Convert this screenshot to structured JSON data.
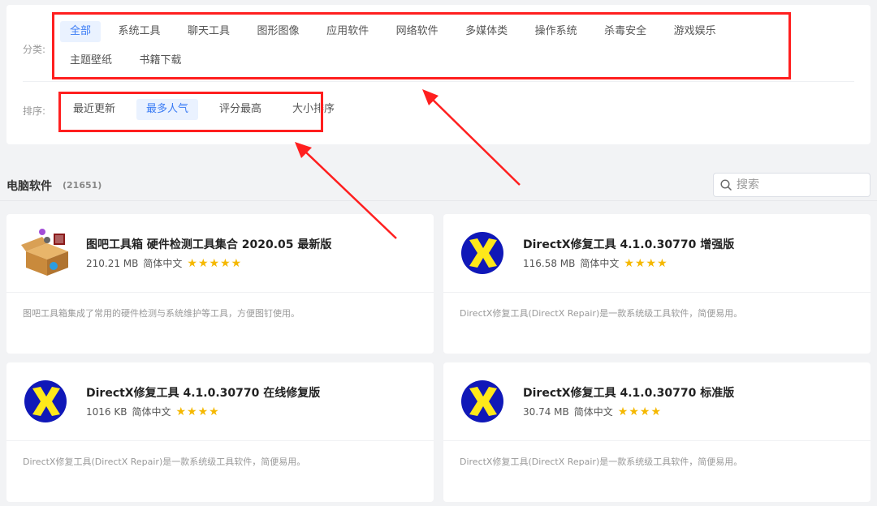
{
  "filters": {
    "category_label": "分类:",
    "categories": [
      "全部",
      "系统工具",
      "聊天工具",
      "图形图像",
      "应用软件",
      "网络软件",
      "多媒体类",
      "操作系统",
      "杀毒安全",
      "游戏娱乐",
      "主题壁纸",
      "书籍下载"
    ],
    "active_category": 0,
    "sort_label": "排序:",
    "sorts": [
      "最近更新",
      "最多人气",
      "评分最高",
      "大小排序"
    ],
    "active_sort": 1
  },
  "section": {
    "title": "电脑软件",
    "count": "(21651)"
  },
  "search": {
    "placeholder": "搜索"
  },
  "cards": [
    {
      "icon": "toolbox-icon",
      "title": "图吧工具箱 硬件检测工具集合 2020.05 最新版",
      "size": "210.21 MB",
      "lang": "简体中文",
      "stars": 5,
      "desc": "图吧工具箱集成了常用的硬件检测与系统维护等工具，方便图钉使用。"
    },
    {
      "icon": "directx-icon",
      "title": "DirectX修复工具 4.1.0.30770 增强版",
      "size": "116.58 MB",
      "lang": "简体中文",
      "stars": 4,
      "desc": "DirectX修复工具(DirectX Repair)是一款系统级工具软件，简便易用。"
    },
    {
      "icon": "directx-icon",
      "title": "DirectX修复工具 4.1.0.30770 在线修复版",
      "size": "1016 KB",
      "lang": "简体中文",
      "stars": 4,
      "desc": "DirectX修复工具(DirectX Repair)是一款系统级工具软件，简便易用。"
    },
    {
      "icon": "directx-icon",
      "title": "DirectX修复工具 4.1.0.30770 标准版",
      "size": "30.74 MB",
      "lang": "简体中文",
      "stars": 4,
      "desc": "DirectX修复工具(DirectX Repair)是一款系统级工具软件，简便易用。"
    }
  ],
  "colors": {
    "accent": "#3b7cf5",
    "accent_bg": "#eaf2ff",
    "star": "#f5b800",
    "annotation": "#ff1f1f"
  }
}
